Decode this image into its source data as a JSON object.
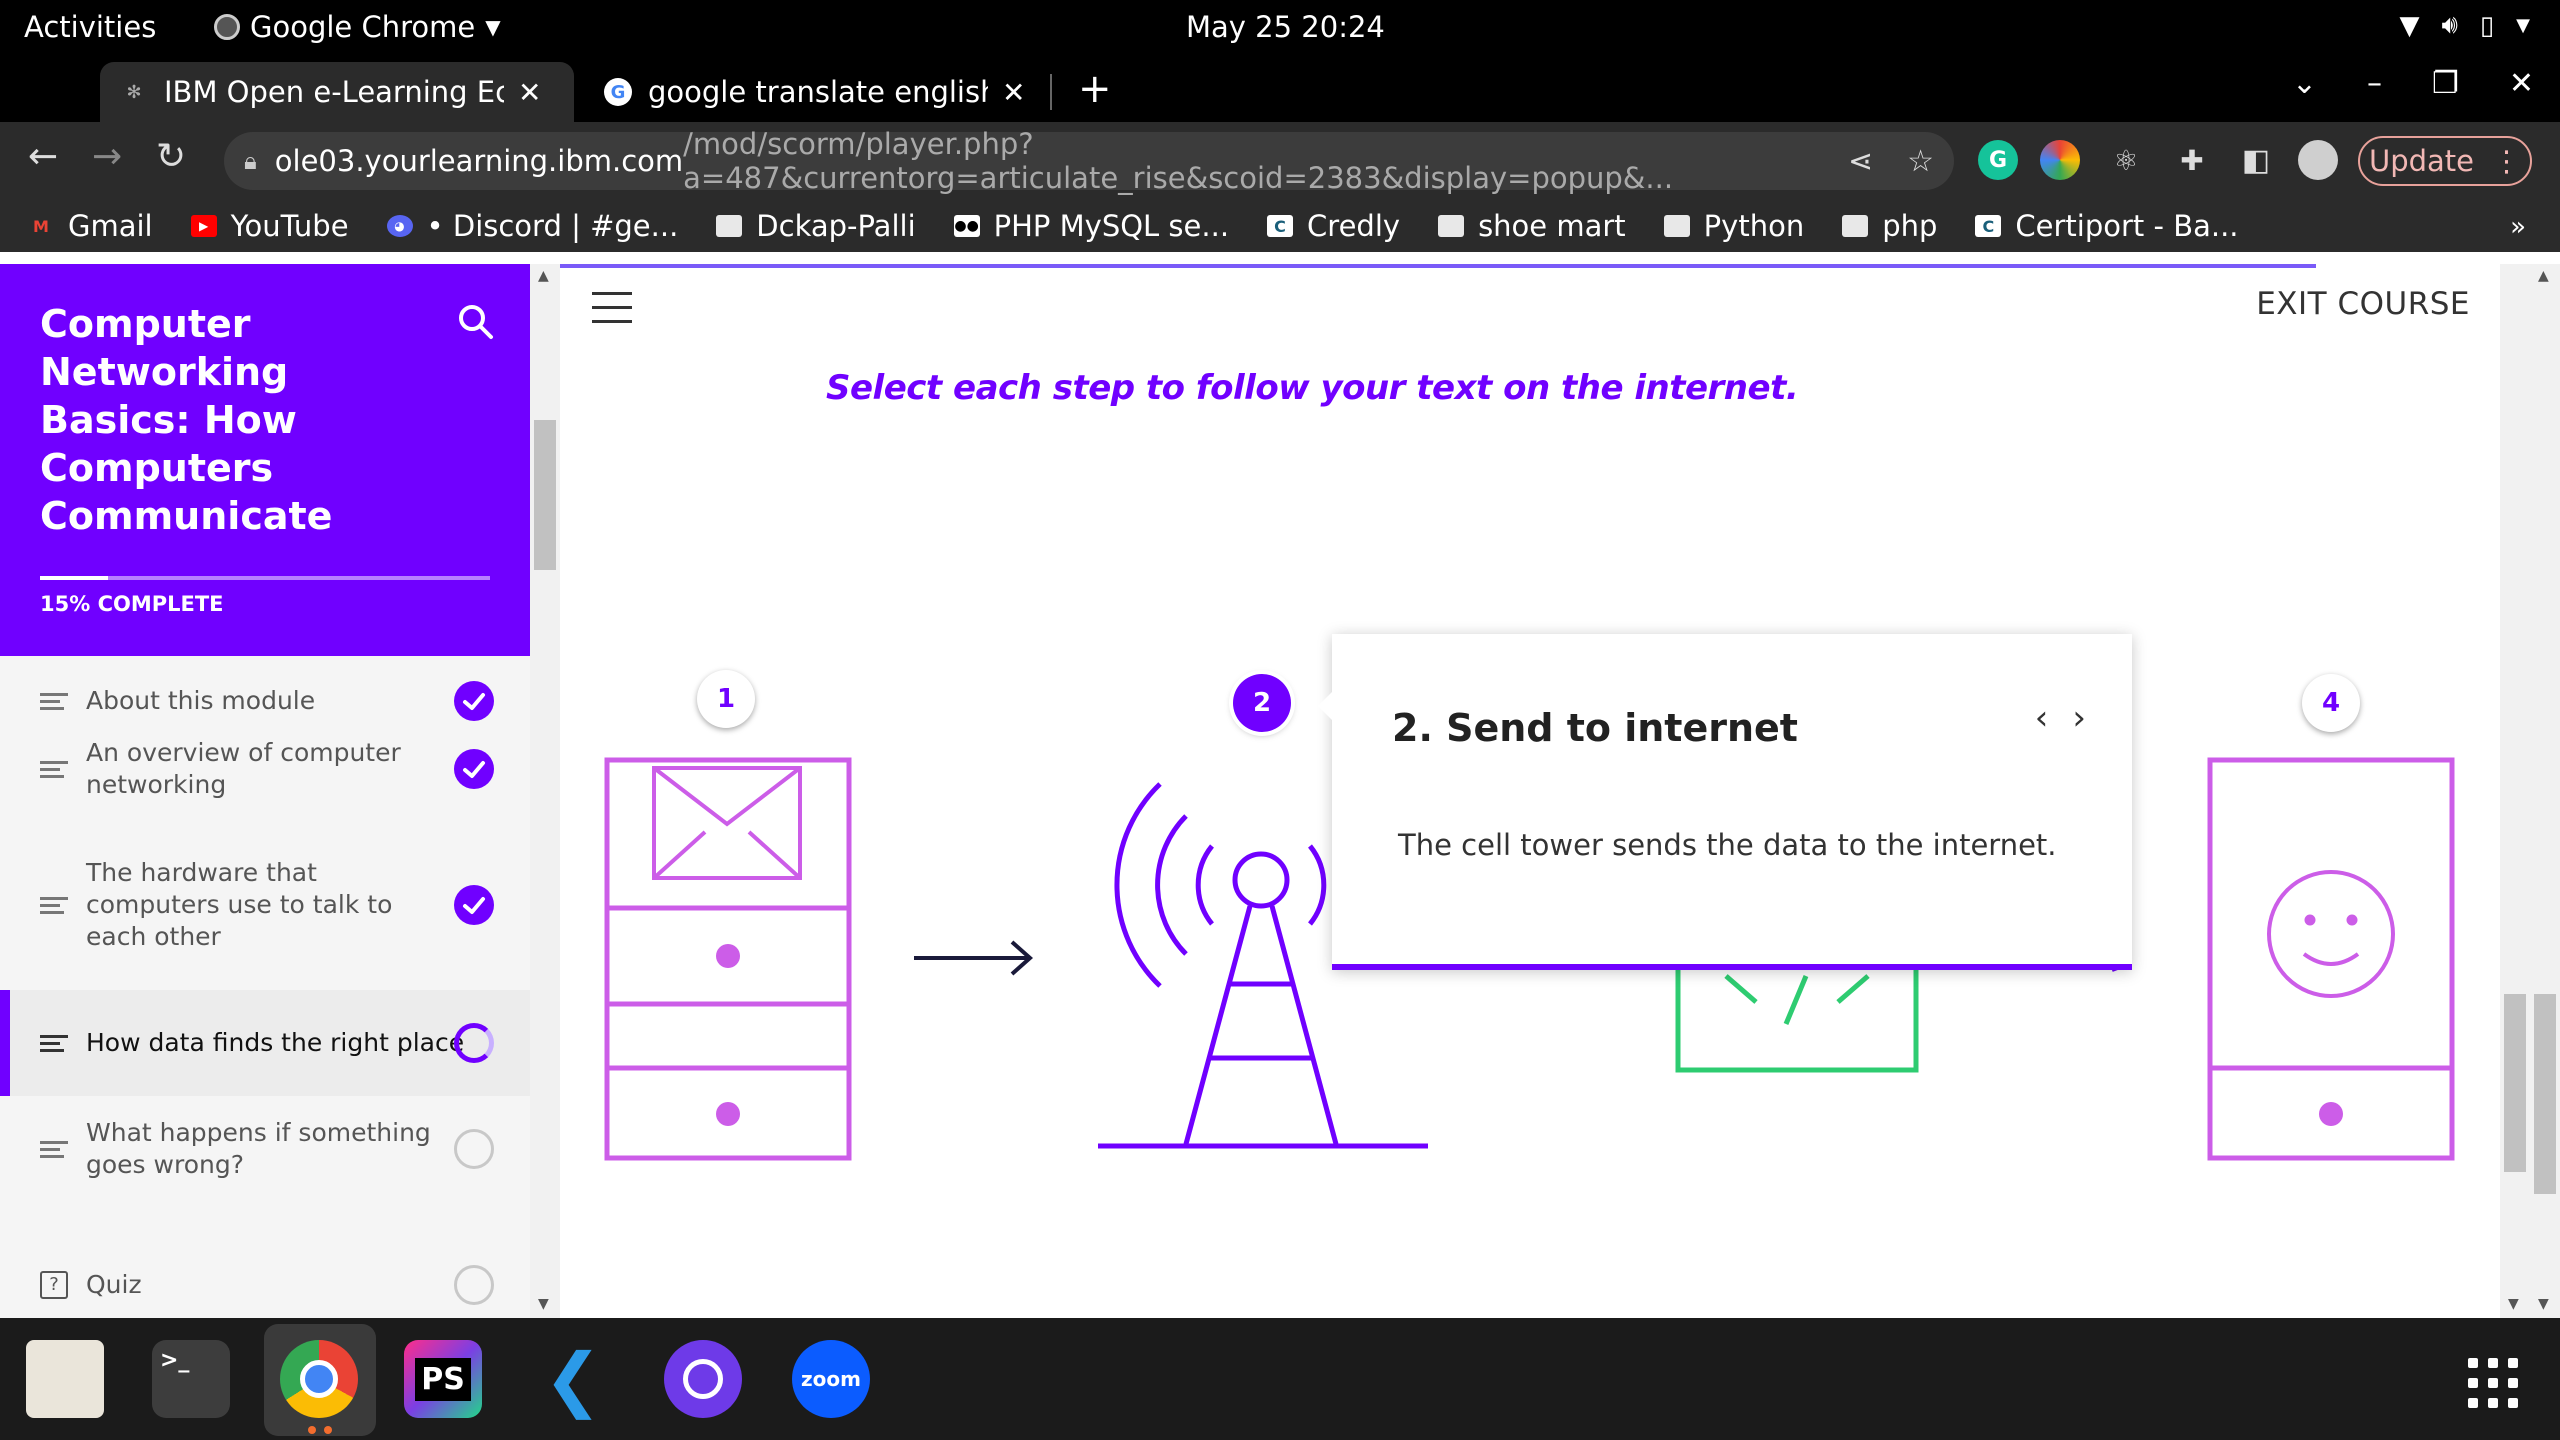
{
  "system": {
    "activities": "Activities",
    "app_name": "Google Chrome",
    "datetime": "May 25  20:24"
  },
  "tabs": [
    {
      "title": "IBM Open e-Learning Ecos",
      "active": true
    },
    {
      "title": "google translate english t",
      "active": false
    }
  ],
  "address": {
    "domain": "ole03.yourlearning.ibm.com",
    "path": "/mod/scorm/player.php?a=487&currentorg=articulate_rise&scoid=2383&display=popup&..."
  },
  "update_label": "Update",
  "bookmarks": [
    {
      "label": "Gmail",
      "icon": "gmail-icon"
    },
    {
      "label": "YouTube",
      "icon": "youtube-icon"
    },
    {
      "label": "• Discord | #ge...",
      "icon": "discord-icon"
    },
    {
      "label": "Dckap-Palli",
      "icon": "folder-icon"
    },
    {
      "label": "PHP MySQL se...",
      "icon": "medium-icon"
    },
    {
      "label": "Credly",
      "icon": "credly-icon"
    },
    {
      "label": "shoe mart",
      "icon": "folder-icon"
    },
    {
      "label": "Python",
      "icon": "folder-icon"
    },
    {
      "label": "php",
      "icon": "folder-icon"
    },
    {
      "label": "Certiport - Ba...",
      "icon": "credly-icon"
    }
  ],
  "bookmarks_more": "»",
  "course": {
    "title": "Computer Networking Basics: How Computers Communicate",
    "progress_label": "15% COMPLETE",
    "progress_fraction": 0.15,
    "lessons": [
      {
        "label": "About this module",
        "status": "complete"
      },
      {
        "label": "An overview of computer networking",
        "status": "complete"
      },
      {
        "label": "The hardware that computers use to talk to each other",
        "status": "complete"
      },
      {
        "label": "How data finds the right place",
        "status": "in-progress"
      },
      {
        "label": "What happens if something goes wrong?",
        "status": "not-started"
      },
      {
        "label": "Quiz",
        "status": "not-started"
      }
    ]
  },
  "main": {
    "exit_label": "EXIT COURSE",
    "instruction": "Select each step to follow your text on the internet.",
    "markers": [
      "1",
      "2",
      "4"
    ],
    "popup": {
      "title": "2. Send to internet",
      "body": "The cell tower sends the data to the internet."
    }
  },
  "colors": {
    "brand": "#7000ff",
    "phone": "#cc5de8",
    "router": "#2ecc71"
  }
}
